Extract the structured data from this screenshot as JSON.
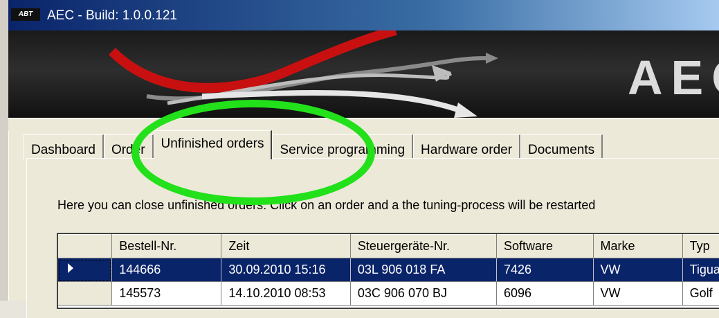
{
  "window": {
    "title": "AEC - Build: 1.0.0.121",
    "logo_text": "ABT"
  },
  "banner": {
    "brand": "AEC"
  },
  "tabs": [
    {
      "label": "Dashboard"
    },
    {
      "label": "Order"
    },
    {
      "label": "Unfinished orders"
    },
    {
      "label": "Service programming"
    },
    {
      "label": "Hardware order"
    },
    {
      "label": "Documents"
    }
  ],
  "active_tab": "Unfinished orders",
  "info_text": "Here you can close unfinished orders. Click on an order and a the tuning-process will be restarted",
  "grid": {
    "columns": [
      "Bestell-Nr.",
      "Zeit",
      "Steuergeräte-Nr.",
      "Software",
      "Marke",
      "Typ"
    ],
    "rows": [
      {
        "bestell": "144666",
        "zeit": "30.09.2010 15:16",
        "steuer": "03L 906 018 FA",
        "software": "7426",
        "marke": "VW",
        "typ": "Tiguan"
      },
      {
        "bestell": "145573",
        "zeit": "14.10.2010 08:53",
        "steuer": "03C 906 070 BJ",
        "software": "6096",
        "marke": "VW",
        "typ": "Golf"
      }
    ]
  },
  "colors": {
    "highlight": "#22e01a",
    "selection": "#0a246a"
  }
}
